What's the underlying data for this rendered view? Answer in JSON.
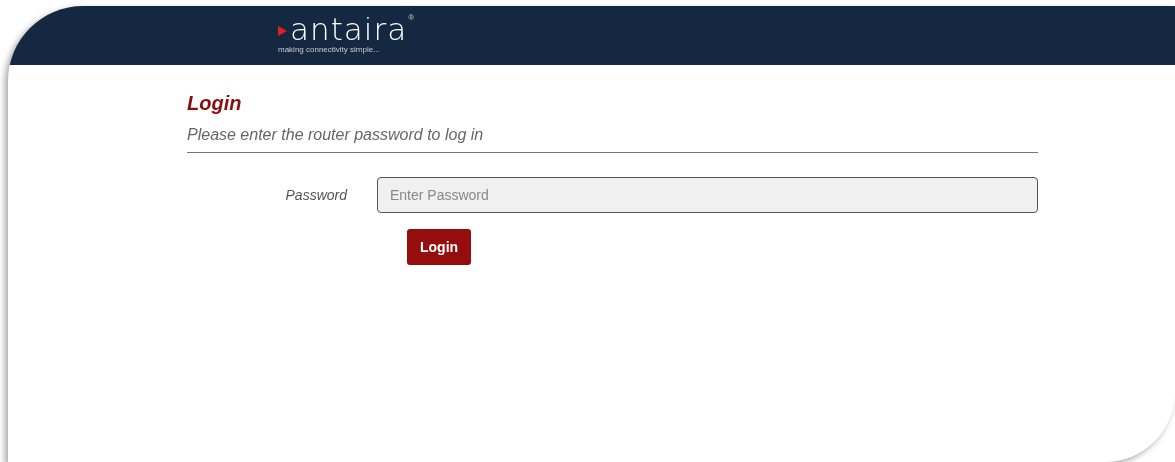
{
  "header": {
    "logo": "antaira",
    "logo_mark": "®",
    "tagline": "making connectivity simple..."
  },
  "login": {
    "title": "Login",
    "subtitle": "Please enter the router password to log in",
    "fields": [
      {
        "label": "Password",
        "placeholder": "Enter Password"
      }
    ],
    "button": "Login"
  }
}
